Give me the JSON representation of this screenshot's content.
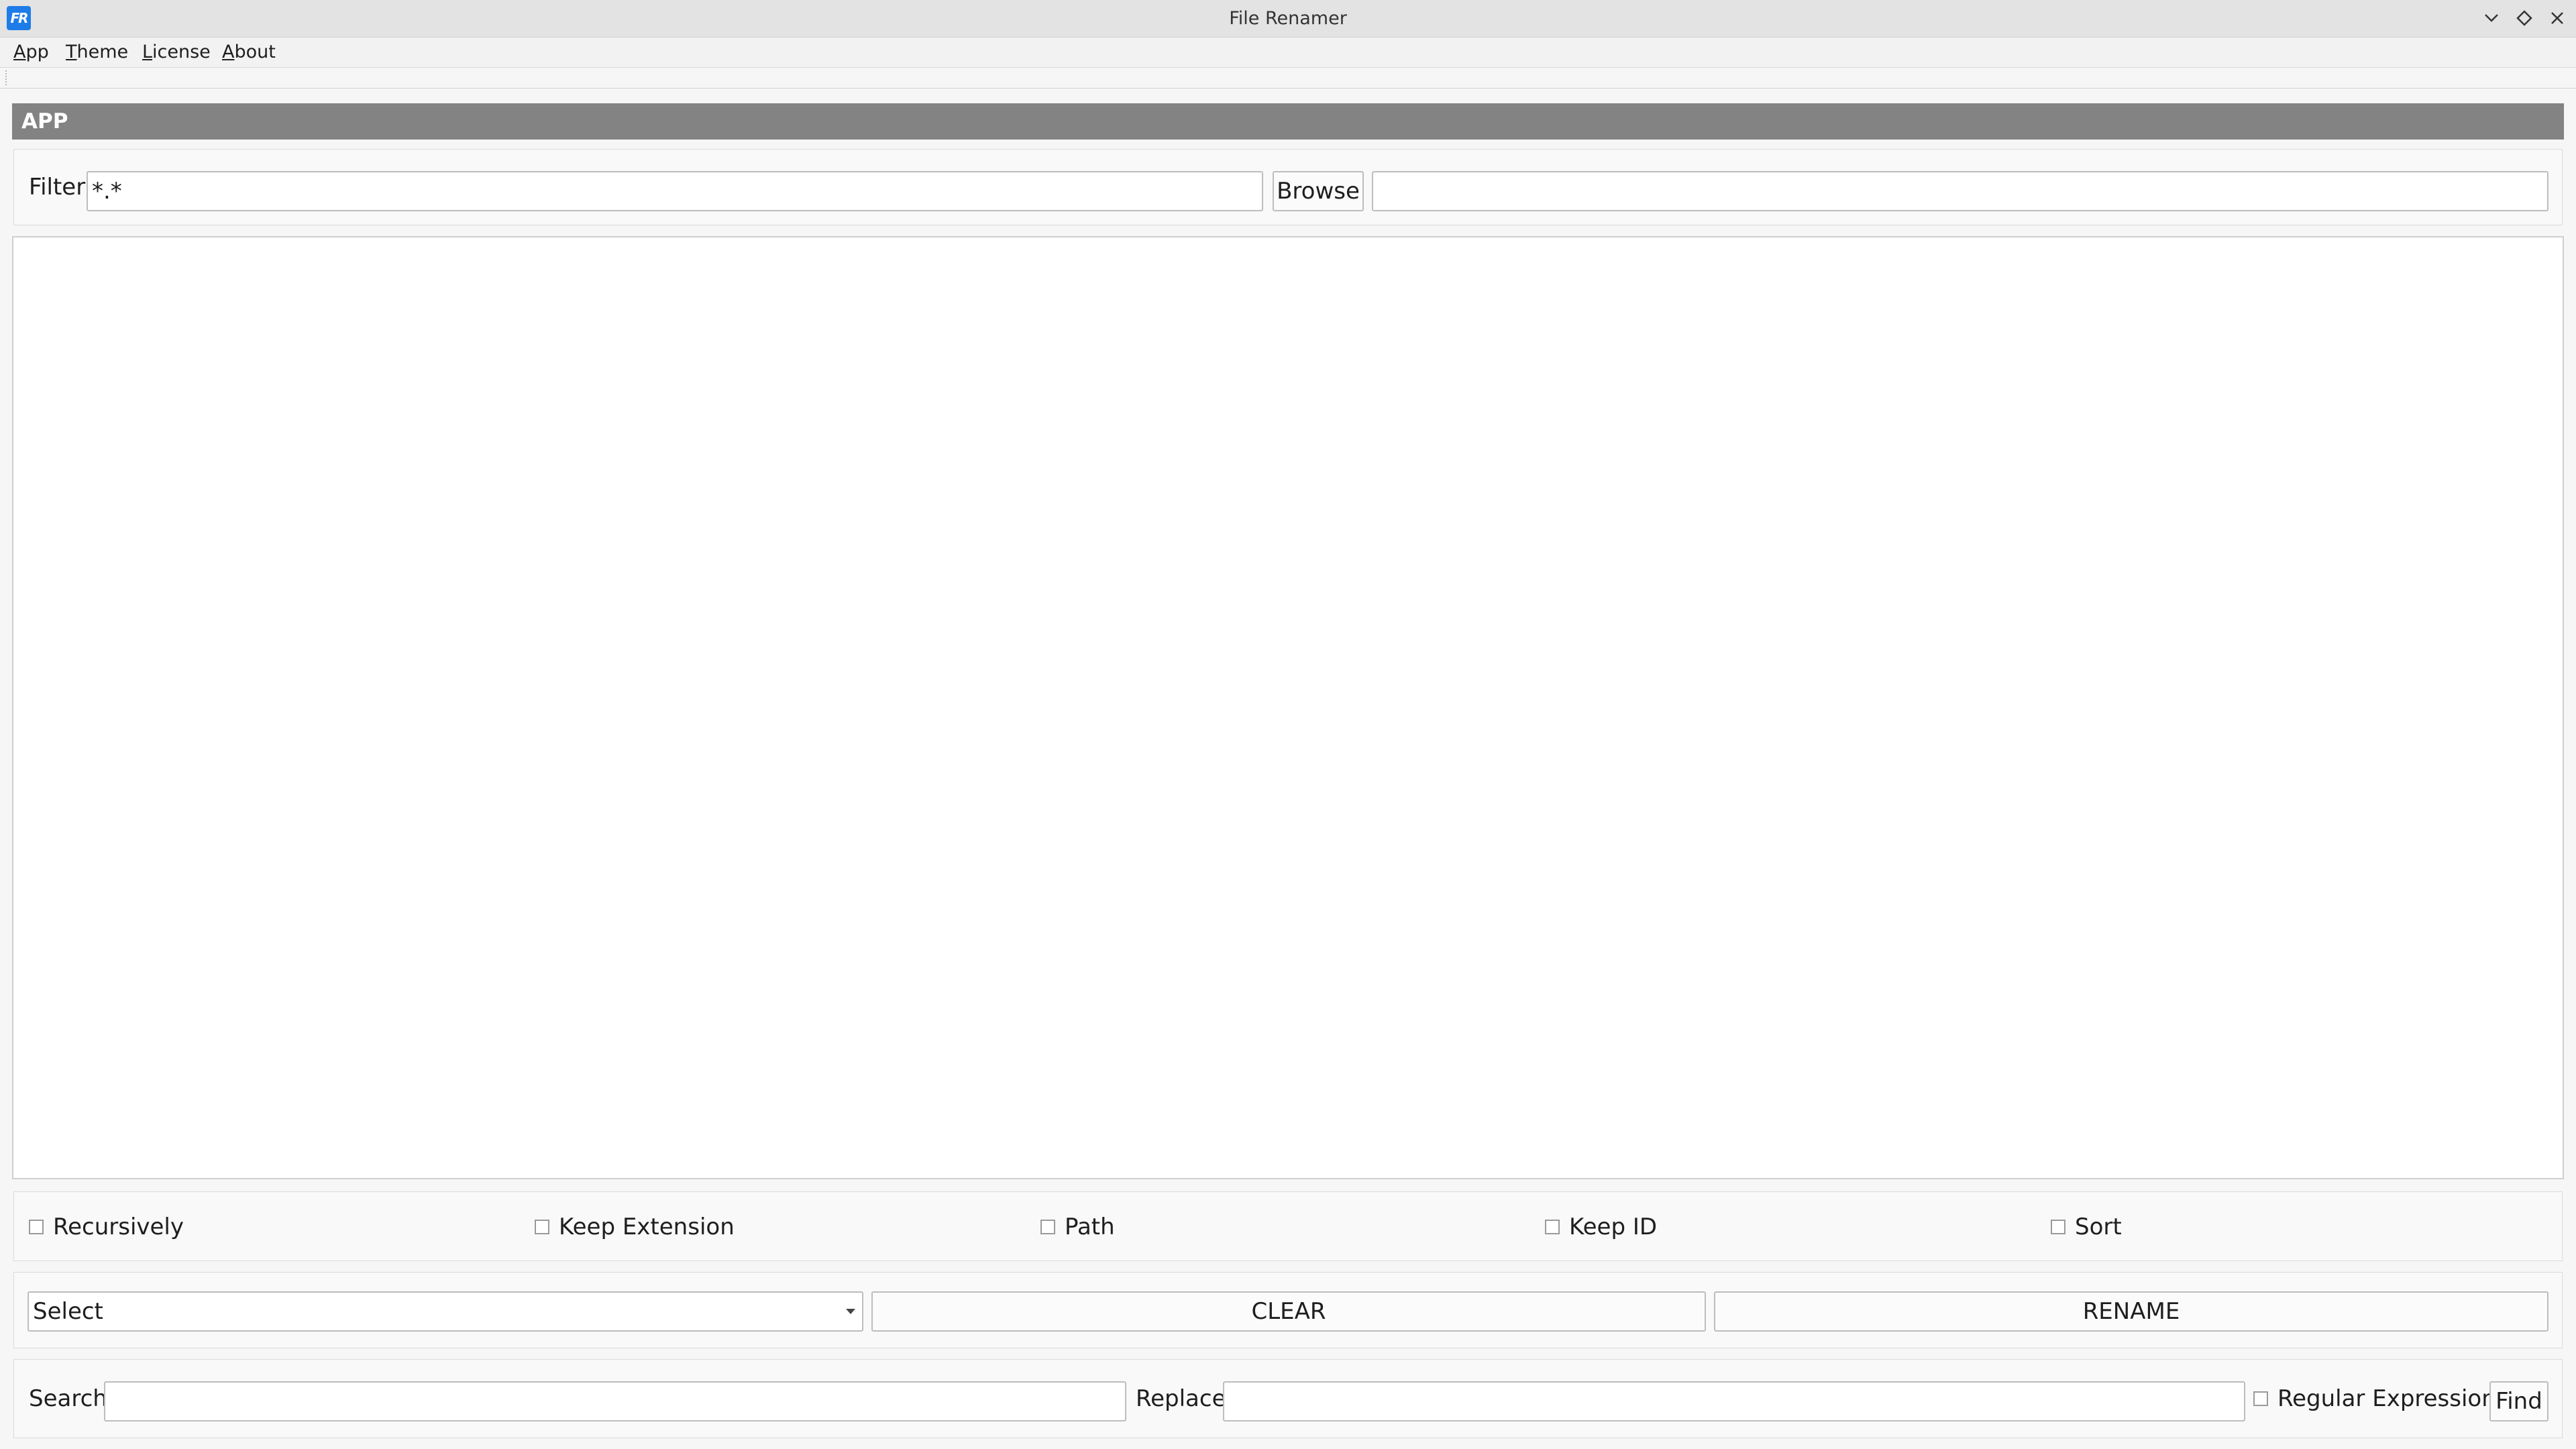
{
  "window": {
    "title": "File Renamer",
    "logo_text": "FR"
  },
  "menu": {
    "items": [
      "App",
      "Theme",
      "License",
      "About"
    ]
  },
  "section": {
    "title": "APP"
  },
  "filter": {
    "label": "Filter",
    "value": "*.*",
    "browse_label": "Browse",
    "path_value": ""
  },
  "options": {
    "recursively": "Recursively",
    "keep_extension": "Keep Extension",
    "path": "Path",
    "keep_id": "Keep ID",
    "sort": "Sort"
  },
  "actions": {
    "select_value": "Select",
    "clear_label": "CLEAR",
    "rename_label": "RENAME"
  },
  "search": {
    "search_label": "Search",
    "search_value": "",
    "replace_label": "Replace",
    "replace_value": "",
    "regex_label": "Regular Expression",
    "find_label": "Find"
  },
  "colors": {
    "logo": "#1e7ce8",
    "section_header": "#838383"
  },
  "icons": {
    "minimize": "chevron-down-icon",
    "restore": "diamond-icon",
    "close": "close-icon"
  }
}
